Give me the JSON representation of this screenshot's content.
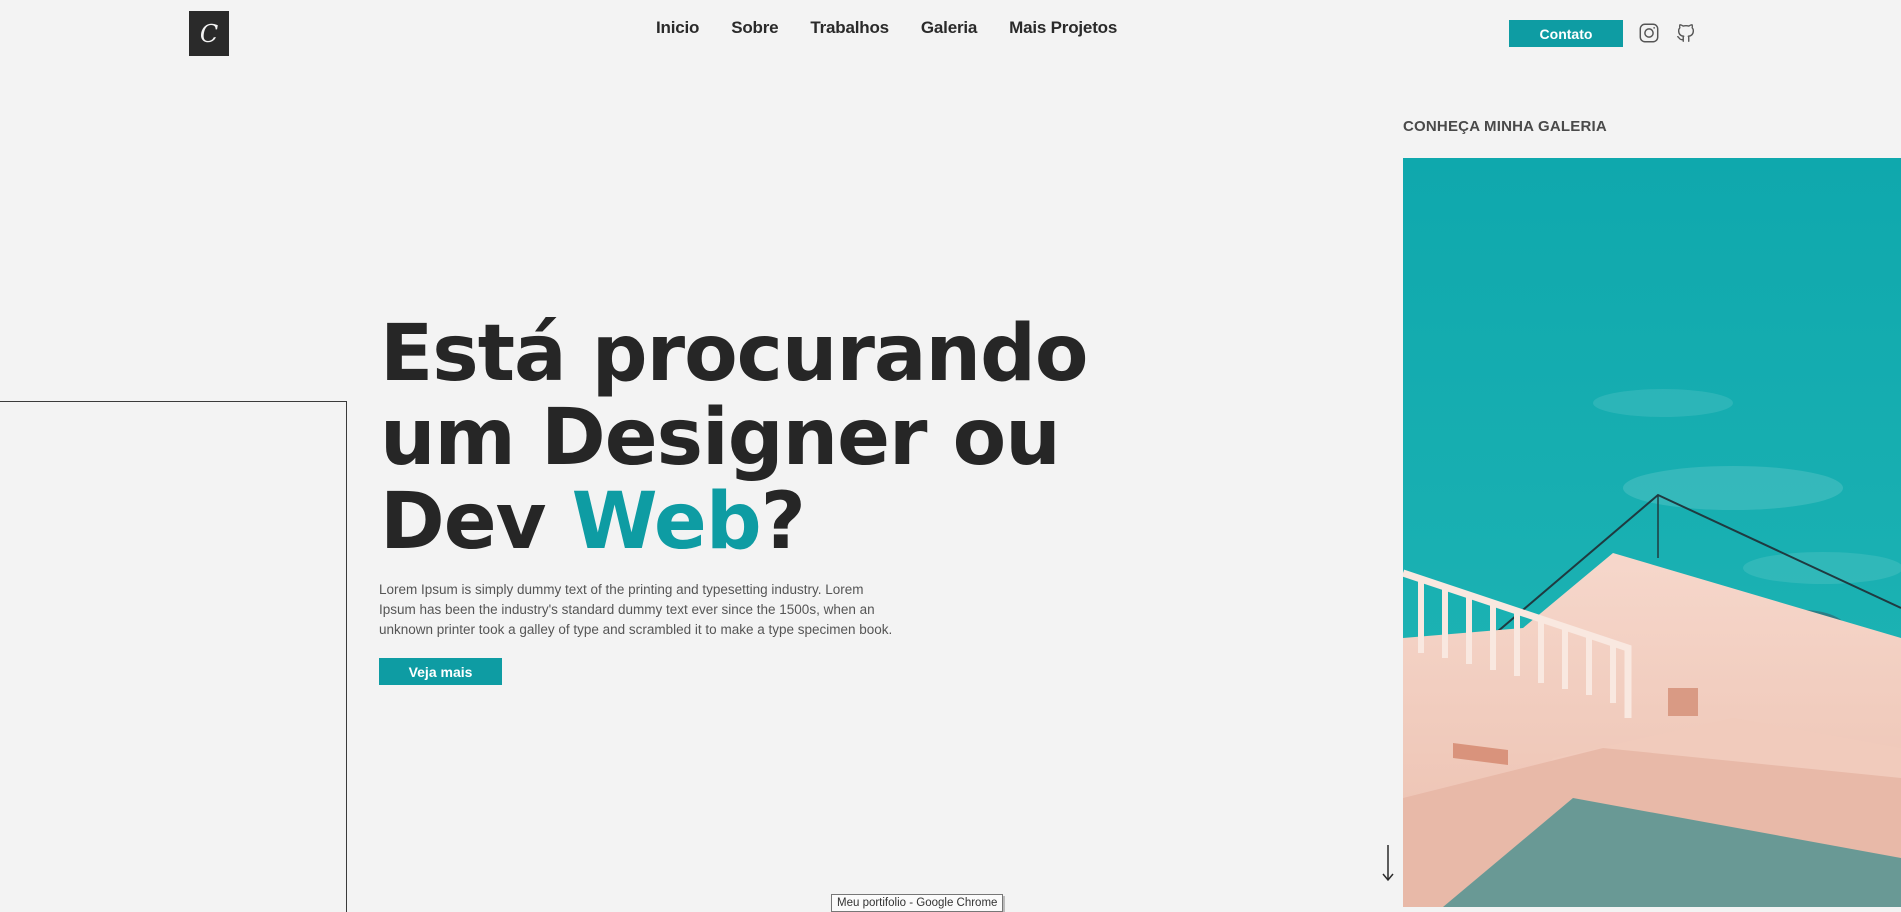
{
  "header": {
    "logo_letter": "C",
    "nav": [
      "Inicio",
      "Sobre",
      "Trabalhos",
      "Galeria",
      "Mais Projetos"
    ],
    "contact_label": "Contato",
    "social_icons": [
      "instagram-icon",
      "github-icon"
    ]
  },
  "hero": {
    "title_line1": "Está procurando",
    "title_line2": "um Designer ou",
    "title_line3_prefix": "Dev ",
    "title_line3_accent": "Web",
    "title_line3_suffix": "?",
    "description": "Lorem Ipsum is simply dummy text of the printing and typesetting industry. Lorem Ipsum has been the industry's standard dummy text ever since the 1500s, when an unknown printer took a galley of type and scrambled it to make a type specimen book.",
    "cta_label": "Veja mais"
  },
  "gallery": {
    "heading": "CONHEÇA MINHA GALERIA"
  },
  "tooltip": "Meu portifolio - Google Chrome",
  "colors": {
    "accent": "#0e9ca3",
    "background": "#f3f3f3",
    "text": "#262626"
  }
}
